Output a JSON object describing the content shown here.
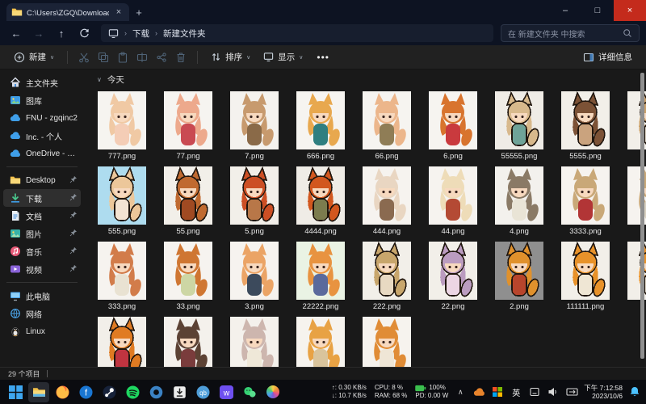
{
  "window": {
    "tab_title": "C:\\Users\\ZGQ\\Downloads\\新建...",
    "breadcrumb": [
      "下载",
      "新建文件夹"
    ],
    "search_placeholder": "在 新建文件夹 中搜索",
    "status_text": "29 个项目",
    "controls": {
      "minimize": "–",
      "maximize": "□",
      "close": "×"
    }
  },
  "toolbar": {
    "new_label": "新建",
    "sort_label": "排序",
    "view_label": "显示",
    "more_label": "…",
    "details_label": "详细信息"
  },
  "colors": {
    "titlebar": "#0d1322",
    "commandbar": "#212121",
    "body": "#191919",
    "close_red": "#c42b1c",
    "selection": "#2f2f2f",
    "scrollbar": "#8f8f8f"
  },
  "sidebar": {
    "sections": [
      [
        {
          "label": "主文件夹",
          "icon": "home"
        },
        {
          "label": "图库",
          "icon": "gallery"
        },
        {
          "label": "FNU - zgqinc2",
          "icon": "cloud"
        },
        {
          "label": "Inc. - 个人",
          "icon": "cloud"
        },
        {
          "label": "OneDrive - zgqinc",
          "icon": "cloud"
        }
      ],
      [
        {
          "label": "Desktop",
          "icon": "folder",
          "pinned": true
        },
        {
          "label": "下载",
          "icon": "download",
          "pinned": true,
          "selected": true
        },
        {
          "label": "文档",
          "icon": "document",
          "pinned": true
        },
        {
          "label": "图片",
          "icon": "picture",
          "pinned": true
        },
        {
          "label": "音乐",
          "icon": "music",
          "pinned": true
        },
        {
          "label": "视频",
          "icon": "video",
          "pinned": true
        }
      ],
      [
        {
          "label": "此电脑",
          "icon": "pc"
        },
        {
          "label": "网络",
          "icon": "network"
        },
        {
          "label": "Linux",
          "icon": "linux"
        }
      ]
    ]
  },
  "files": {
    "group": "今天",
    "rows": [
      [
        {
          "label": "777.png",
          "bg": "#f6f4f0",
          "hair": "#f0c9a4",
          "dress": "#f4cdb6"
        },
        {
          "label": "77.png",
          "bg": "#f6f4f0",
          "hair": "#eda98c",
          "dress": "#c94a52"
        },
        {
          "label": "7.png",
          "bg": "#f4f2ee",
          "hair": "#c79a6e",
          "dress": "#8a6a48"
        },
        {
          "label": "666.png",
          "bg": "#f6f4f0",
          "hair": "#e8a84e",
          "dress": "#2f7f80"
        },
        {
          "label": "66.png",
          "bg": "#f6f4f0",
          "hair": "#ecb68b",
          "dress": "#8f7d56"
        },
        {
          "label": "6.png",
          "bg": "#f6f4f0",
          "hair": "#d8742e",
          "dress": "#c93a3e"
        },
        {
          "label": "55555.png",
          "bg": "#efece6",
          "hair": "#d8b98c",
          "dress": "#6fa398",
          "pixel": true
        },
        {
          "label": "5555.png",
          "bg": "#f2efe9",
          "hair": "#7c5236",
          "dress": "#caa37e",
          "pixel": true
        },
        {
          "label": "",
          "partial": true,
          "bg": "#f2efe9",
          "hair": "#c9a06a",
          "dress": "#d8d0c0",
          "pixel": true
        }
      ],
      [
        {
          "label": "555.png",
          "bg": "#aedcef",
          "hair": "#ecc79a",
          "dress": "#f3e3d2",
          "pixel": true
        },
        {
          "label": "55.png",
          "bg": "#f2efe9",
          "hair": "#c06a30",
          "dress": "#a04a22",
          "pixel": true
        },
        {
          "label": "5.png",
          "bg": "#f2efe9",
          "hair": "#cc4f24",
          "dress": "#b87748",
          "pixel": true
        },
        {
          "label": "4444.png",
          "bg": "#efece6",
          "hair": "#d2571e",
          "dress": "#7c7c4e",
          "pixel": true
        },
        {
          "label": "444.png",
          "bg": "#f6f3ef",
          "hair": "#e9d6c2",
          "dress": "#8a6a50"
        },
        {
          "label": "44.png",
          "bg": "#f6f3ef",
          "hair": "#eedcb8",
          "dress": "#b44a34"
        },
        {
          "label": "4.png",
          "bg": "#f3f1ed",
          "hair": "#8a7a66",
          "dress": "#e9e4d6"
        },
        {
          "label": "3333.png",
          "bg": "#f6f3ef",
          "hair": "#c9a878",
          "dress": "#b23536"
        },
        {
          "label": "",
          "partial": true,
          "bg": "#f6f3ef",
          "hair": "#c9a878",
          "dress": "#d8d0c0"
        }
      ],
      [
        {
          "label": "333.png",
          "bg": "#f6f3ef",
          "hair": "#d27c4a",
          "dress": "#e9e2d2"
        },
        {
          "label": "33.png",
          "bg": "#f6f3ef",
          "hair": "#cf7632",
          "dress": "#cdd6a4"
        },
        {
          "label": "3.png",
          "bg": "#f6f3ef",
          "hair": "#eba466",
          "dress": "#3c4a5c"
        },
        {
          "label": "22222.png",
          "bg": "#eaf3e4",
          "hair": "#e89340",
          "dress": "#5a6a9c"
        },
        {
          "label": "222.png",
          "bg": "#f2efe9",
          "hair": "#c8a66c",
          "dress": "#e8d9c2",
          "pixel": true
        },
        {
          "label": "22.png",
          "bg": "#f2efe9",
          "hair": "#bb9cc0",
          "dress": "#ecd6e4",
          "pixel": true
        },
        {
          "label": "2.png",
          "bg": "#8f8f8f",
          "hair": "#e0912c",
          "dress": "#b8452c",
          "pixel": true
        },
        {
          "label": "111111.png",
          "bg": "#f2efe9",
          "hair": "#e8922a",
          "dress": "#efe6d4",
          "pixel": true
        },
        {
          "label": "",
          "partial": true,
          "bg": "#f2efe9",
          "hair": "#e8922a",
          "dress": "#d8d0c0",
          "pixel": true
        }
      ],
      [
        {
          "label": "",
          "bg": "#f2efe9",
          "hair": "#e07b22",
          "dress": "#c03440",
          "pixel": true
        },
        {
          "label": "",
          "bg": "#f4f1ec",
          "hair": "#5c4234",
          "dress": "#7a3c3c"
        },
        {
          "label": "",
          "bg": "#f4f1ec",
          "hair": "#cdb6ae",
          "dress": "#efe8d8"
        },
        {
          "label": "",
          "bg": "#f6f3ee",
          "hair": "#e8a244",
          "dress": "#d9c49c"
        },
        {
          "label": "",
          "bg": "#f6f3ee",
          "hair": "#e08c36",
          "dress": "#efe6d6"
        }
      ]
    ]
  },
  "taskbar": {
    "apps": [
      {
        "name": "start-button",
        "icon": "start"
      },
      {
        "name": "file-explorer",
        "icon": "explorer",
        "active": true
      },
      {
        "name": "firefox",
        "icon": "firefox"
      },
      {
        "name": "blue-f-app",
        "icon": "blue-f"
      },
      {
        "name": "steam",
        "icon": "steam"
      },
      {
        "name": "spotify",
        "icon": "spotify"
      },
      {
        "name": "loop-app",
        "icon": "ring"
      },
      {
        "name": "downloader-app",
        "icon": "download-box"
      },
      {
        "name": "qbittorrent",
        "icon": "qb"
      },
      {
        "name": "wemod",
        "icon": "wemod"
      },
      {
        "name": "wechat",
        "icon": "wechat"
      },
      {
        "name": "paint-app",
        "icon": "color-wheel"
      }
    ]
  },
  "tray": {
    "net_up": "↑: 0.30 KB/s",
    "net_down": "↓: 10.7 KB/s",
    "cpu": "CPU: 8 %",
    "ram": "RAM: 68 %",
    "battery": "100%",
    "power": "PD: 0.00 W",
    "hidden_chevron": "∧",
    "ime": "英",
    "time": "下午 7:12:58",
    "date": "2023/10/6"
  }
}
